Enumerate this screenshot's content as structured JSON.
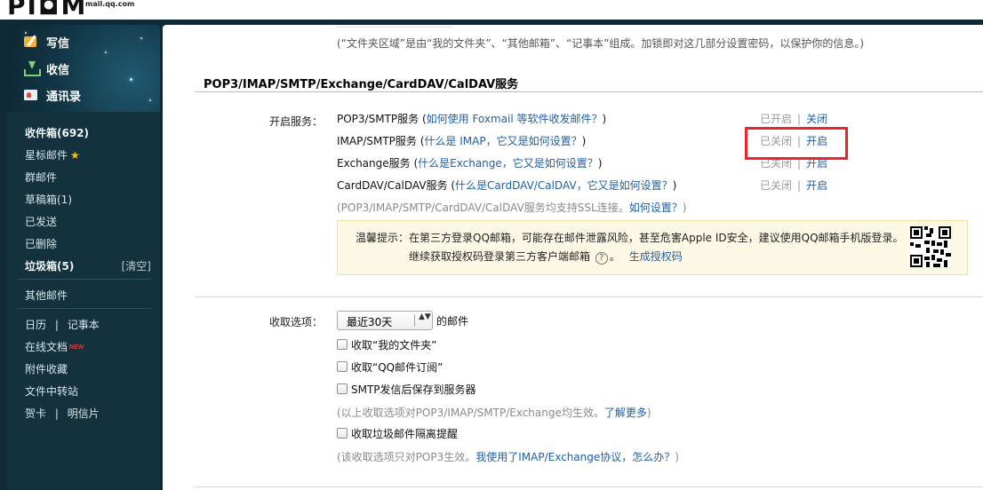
{
  "logo": {
    "mark": "PI◘M",
    "sub": "mail.qq.com"
  },
  "sidebar": {
    "compose": "写信",
    "receive": "收信",
    "contacts": "通讯录",
    "folders": {
      "inbox": "收件箱(692)",
      "starred": "星标邮件",
      "group": "群邮件",
      "drafts": "草稿箱(1)",
      "sent": "已发送",
      "deleted": "已删除",
      "spam": "垃圾箱(5)",
      "spam_clear": "[清空]",
      "other": "其他邮件",
      "calendar": "日历",
      "sep1": "|",
      "notes": "记事本",
      "docs": "在线文档",
      "docs_badge": "NEW",
      "attachments": "附件收藏",
      "transfer": "文件中转站",
      "cards": "贺卡",
      "sep2": "|",
      "postcards": "明信片"
    }
  },
  "main": {
    "top_hint": "(“文件夹区域”是由“我的文件夹”、“其他邮箱”、“记事本”组成。加锁即对这几部分设置密码，以保护你的信息。)",
    "section_title": "POP3/IMAP/SMTP/Exchange/CardDAV/CalDAV服务",
    "enable_label": "开启服务：",
    "services": [
      {
        "name": "POP3/SMTP服务",
        "open_paren": " (",
        "link": "如何使用 Foxmail 等软件收发邮件？",
        "close_paren": ")",
        "status": "已开启",
        "sep": "|",
        "action": "关闭"
      },
      {
        "name": "IMAP/SMTP服务",
        "open_paren": " (",
        "link": "什么是 IMAP，它又是如何设置？",
        "close_paren": ")",
        "status": "已关闭",
        "sep": "|",
        "action": "开启"
      },
      {
        "name": "Exchange服务",
        "open_paren": " (",
        "link": "什么是Exchange，它又是如何设置？",
        "close_paren": ")",
        "status": "已关闭",
        "sep": "|",
        "action": "开启"
      },
      {
        "name": "CardDAV/CalDAV服务",
        "open_paren": " (",
        "link": "什么是CardDAV/CalDAV，它又是如何设置？",
        "close_paren": ")",
        "status": "已关闭",
        "sep": "|",
        "action": "开启"
      }
    ],
    "ssl_note": "(POP3/IMAP/SMTP/CardDAV/CalDAV服务均支持SSL连接。",
    "ssl_link": "如何设置？",
    "ssl_close": ")",
    "warning": {
      "line1": "温馨提示：在第三方登录QQ邮箱，可能存在邮件泄露风险，甚至危害Apple ID安全，建议使用QQ邮箱手机版登录。",
      "line2_prefix": "继续获取授权码登录第三方客户端邮箱",
      "help_mark": "?",
      "line2_mid": "。",
      "line2_link": "生成授权码"
    },
    "receive_label": "收取选项：",
    "select_value": "最近30天",
    "select_arrows": "▲▼",
    "after_select": "的邮件",
    "options": [
      "收取“我的文件夹”",
      "收取“QQ邮件订阅”",
      "SMTP发信后保存到服务器"
    ],
    "options_note": "(以上收取选项对POP3/IMAP/SMTP/Exchange均生效。",
    "options_note_link": "了解更多",
    "options_note_close": ")",
    "spam_option": "收取垃圾邮件隔离提醒",
    "pop3_note": "(该收取选项只对POP3生效。",
    "pop3_note_link": "我使用了IMAP/Exchange协议，怎么办？",
    "pop3_note_close": ")"
  },
  "colors": {
    "link": "#1f5fa8",
    "highlight": "#e8262b",
    "frame": "#0f2a36"
  }
}
